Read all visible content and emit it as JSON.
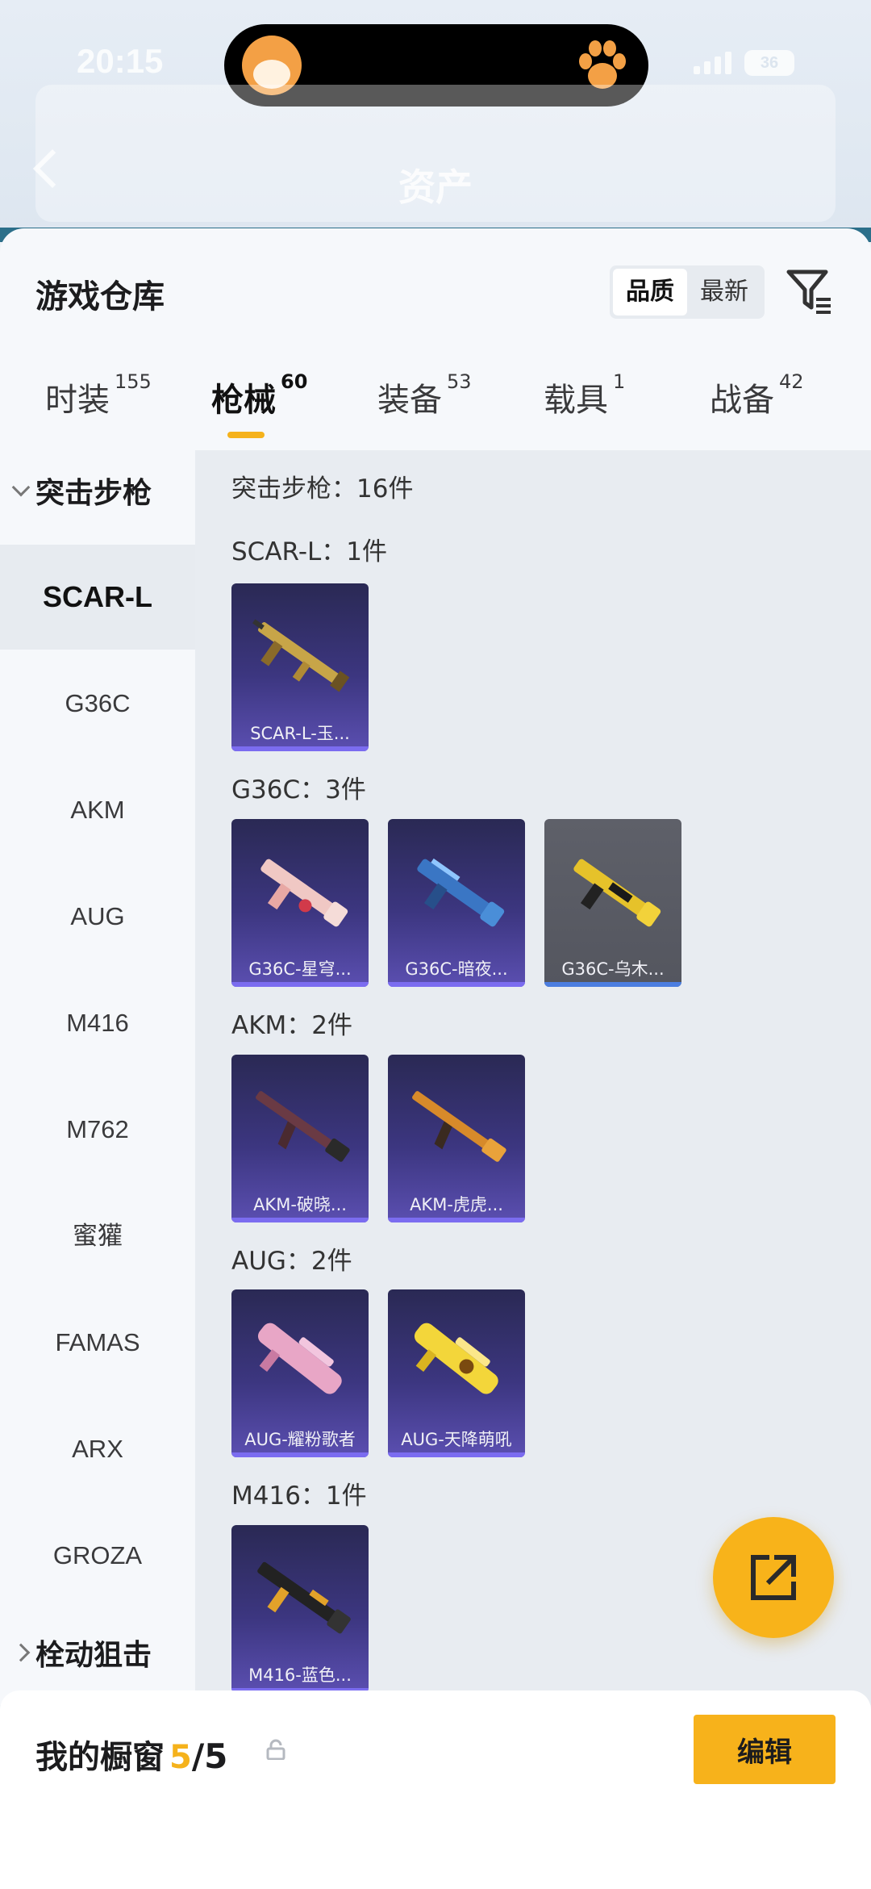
{
  "status": {
    "time": "20:15",
    "battery": "36"
  },
  "header": {
    "title": "资产"
  },
  "sheet": {
    "title": "游戏仓库",
    "sort": {
      "options": [
        "品质",
        "最新"
      ],
      "active": "品质"
    }
  },
  "tabs": [
    {
      "label": "时装",
      "count": "155"
    },
    {
      "label": "枪械",
      "count": "60"
    },
    {
      "label": "装备",
      "count": "53"
    },
    {
      "label": "载具",
      "count": "1"
    },
    {
      "label": "战备",
      "count": "42"
    }
  ],
  "sidebar": {
    "group_open": "突击步枪",
    "items": [
      "SCAR-L",
      "G36C",
      "AKM",
      "AUG",
      "M416",
      "M762",
      "蜜獾",
      "FAMAS",
      "ARX",
      "GROZA"
    ],
    "group_next": "栓动狙击"
  },
  "content": {
    "summary": "突击步枪：16件",
    "sections": [
      {
        "label": "SCAR-L：1件",
        "items": [
          "SCAR-L-玉..."
        ]
      },
      {
        "label": "G36C：3件",
        "items": [
          "G36C-星穹...",
          "G36C-暗夜...",
          "G36C-乌木..."
        ]
      },
      {
        "label": "AKM：2件",
        "items": [
          "AKM-破晓...",
          "AKM-虎虎..."
        ]
      },
      {
        "label": "AUG：2件",
        "items": [
          "AUG-耀粉歌者",
          "AUG-天降萌吼"
        ]
      },
      {
        "label": "M416：1件",
        "items": [
          "M416-蓝色..."
        ]
      }
    ]
  },
  "bottom": {
    "label": "我的橱窗",
    "current": "5",
    "total": "/5",
    "edit": "编辑"
  },
  "colors": {
    "accent": "#f5b21c",
    "card_purple": "#3c3680",
    "card_grey": "#5e6069"
  },
  "icons": [
    "back-icon",
    "filter-icon",
    "share-icon",
    "lock-icon",
    "chevron-down-icon",
    "chevron-right-icon"
  ]
}
